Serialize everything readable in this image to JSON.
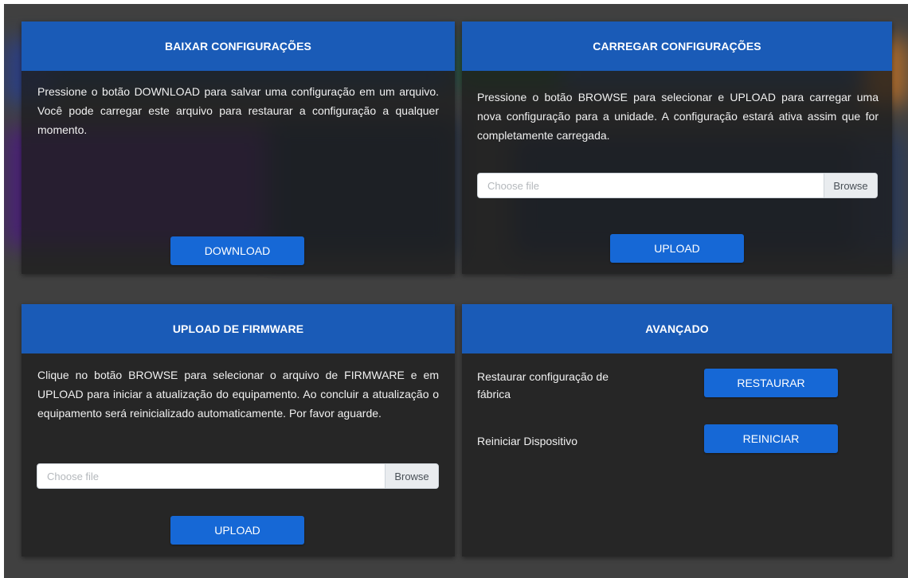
{
  "download_card": {
    "title": "BAIXAR CONFIGURAÇÕES",
    "description": "Pressione o botão DOWNLOAD para salvar uma configuração em um arquivo. Você pode carregar este arquivo para restaurar a configuração a qualquer momento.",
    "button_label": "DOWNLOAD"
  },
  "upload_config_card": {
    "title": "CARREGAR CONFIGURAÇÕES",
    "description": "Pressione o botão BROWSE para selecionar e UPLOAD para carregar uma nova configuração para a unidade. A configuração estará ativa assim que for completamente carregada.",
    "file_placeholder": "Choose file",
    "browse_label": "Browse",
    "button_label": "UPLOAD"
  },
  "firmware_card": {
    "title": "UPLOAD DE FIRMWARE",
    "description": "Clique no botão BROWSE para selecionar o arquivo de FIRMWARE e em UPLOAD para iniciar a atualização do equipamento. Ao concluir a atualização o equipamento será reinicializado automaticamente. Por favor aguarde.",
    "file_placeholder": "Choose file",
    "browse_label": "Browse",
    "button_label": "UPLOAD"
  },
  "advanced_card": {
    "title": "AVANÇADO",
    "factory_reset_label": "Restaurar configuração de fábrica",
    "factory_reset_button": "RESTAURAR",
    "reboot_label": "Reiniciar Dispositivo",
    "reboot_button": "REINICIAR"
  },
  "colors": {
    "header_blue": "#1a5bb7",
    "button_blue": "#1668d6",
    "card_bg": "#262626",
    "page_bg": "#404040"
  }
}
